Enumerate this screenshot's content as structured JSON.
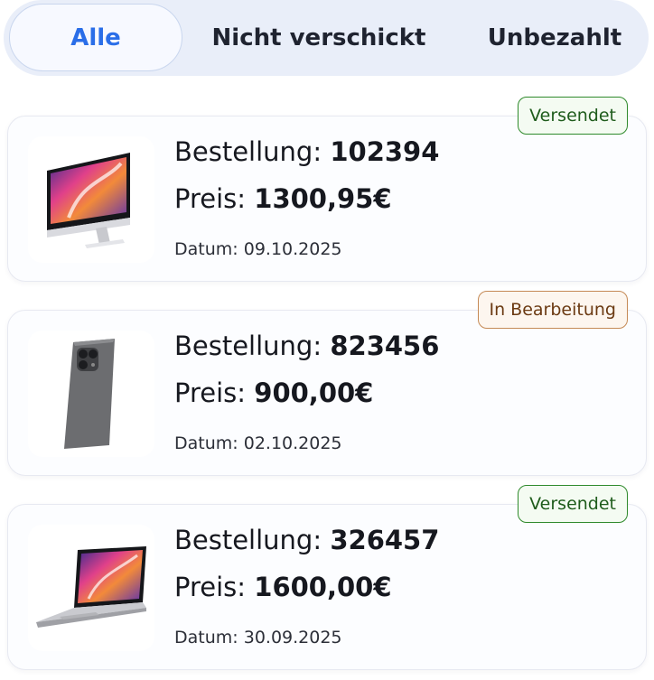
{
  "tabs": [
    {
      "label": "Alle",
      "active": true
    },
    {
      "label": "Nicht verschickt",
      "active": false
    },
    {
      "label": "Unbezahlt",
      "active": false
    }
  ],
  "labels": {
    "order": "Bestellung:",
    "price": "Preis:",
    "date": "Datum:"
  },
  "orders": [
    {
      "status": "Versendet",
      "status_color": "#2f8a2c",
      "product_icon": "imac-icon",
      "order_number": "102394",
      "price": "1300,95€",
      "date": "09.10.2025"
    },
    {
      "status": "In Bearbeitung",
      "status_color": "#c58a56",
      "product_icon": "iphone-icon",
      "order_number": "823456",
      "price": "900,00€",
      "date": "02.10.2025"
    },
    {
      "status": "Versendet",
      "status_color": "#2f8a2c",
      "product_icon": "macbook-icon",
      "order_number": "326457",
      "price": "1600,00€",
      "date": "30.09.2025"
    }
  ],
  "colors": {
    "accent": "#2a6ee8",
    "tab_bar_bg": "#e9eef9"
  }
}
